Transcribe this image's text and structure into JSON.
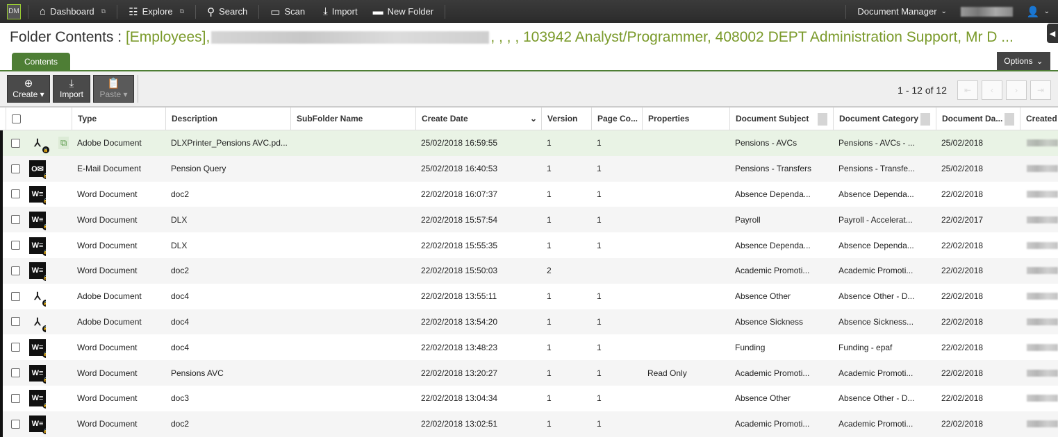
{
  "topbar": {
    "logo": "DM",
    "items": [
      {
        "label": "Dashboard",
        "icon": "home-icon"
      },
      {
        "label": "Explore",
        "icon": "explore-icon"
      },
      {
        "label": "Search",
        "icon": "search-icon"
      },
      {
        "label": "Scan",
        "icon": "scan-icon"
      },
      {
        "label": "Import",
        "icon": "import-icon"
      },
      {
        "label": "New Folder",
        "icon": "new-folder-icon"
      }
    ],
    "app_menu": "Document Manager"
  },
  "header": {
    "prefix": "Folder Contents :",
    "path_start": "[Employees],",
    "path_end": ", , , , 103942 Analyst/Programmer, 408002 DEPT Administration Support, Mr D ..."
  },
  "tabs": {
    "contents": "Contents",
    "options": "Options"
  },
  "toolbar": {
    "create": "Create",
    "import": "Import",
    "paste": "Paste"
  },
  "pager": {
    "count": "1 - 12 of 12"
  },
  "accent": "#4e7e35",
  "columns": [
    "Type",
    "Description",
    "SubFolder Name",
    "Create Date",
    "Version",
    "Page Co...",
    "Properties",
    "Document Subject",
    "Document Category",
    "Document Da...",
    "Created"
  ],
  "rows": [
    [
      "pdf",
      "Adobe Document",
      "DLXPrinter_Pensions AVC.pd...",
      "",
      "25/02/2018 16:59:55",
      "1",
      "1",
      "",
      "Pensions - AVCs",
      "Pensions - AVCs - ...",
      "25/02/2018"
    ],
    [
      "email",
      "E-Mail Document",
      "Pension Query",
      "",
      "25/02/2018 16:40:53",
      "1",
      "1",
      "",
      "Pensions - Transfers",
      "Pensions - Transfe...",
      "25/02/2018"
    ],
    [
      "word",
      "Word Document",
      "doc2",
      "",
      "22/02/2018 16:07:37",
      "1",
      "1",
      "",
      "Absence Dependa...",
      "Absence Dependa...",
      "22/02/2018"
    ],
    [
      "word",
      "Word Document",
      "DLX",
      "",
      "22/02/2018 15:57:54",
      "1",
      "1",
      "",
      "Payroll",
      "Payroll - Accelerat...",
      "22/02/2017"
    ],
    [
      "word",
      "Word Document",
      "DLX",
      "",
      "22/02/2018 15:55:35",
      "1",
      "1",
      "",
      "Absence Dependa...",
      "Absence Dependa...",
      "22/02/2018"
    ],
    [
      "word",
      "Word Document",
      "doc2",
      "",
      "22/02/2018 15:50:03",
      "2",
      "",
      "",
      "Academic Promoti...",
      "Academic Promoti...",
      "22/02/2018"
    ],
    [
      "pdf",
      "Adobe Document",
      "doc4",
      "",
      "22/02/2018 13:55:11",
      "1",
      "1",
      "",
      "Absence Other",
      "Absence Other - D...",
      "22/02/2018"
    ],
    [
      "pdf",
      "Adobe Document",
      "doc4",
      "",
      "22/02/2018 13:54:20",
      "1",
      "1",
      "",
      "Absence Sickness",
      "Absence Sickness...",
      "22/02/2018"
    ],
    [
      "word",
      "Word Document",
      "doc4",
      "",
      "22/02/2018 13:48:23",
      "1",
      "1",
      "",
      "Funding",
      "Funding - epaf",
      "22/02/2018"
    ],
    [
      "word",
      "Word Document",
      "Pensions AVC",
      "",
      "22/02/2018 13:20:27",
      "1",
      "1",
      "Read Only",
      "Academic Promoti...",
      "Academic Promoti...",
      "22/02/2018"
    ],
    [
      "word",
      "Word Document",
      "doc3",
      "",
      "22/02/2018 13:04:34",
      "1",
      "1",
      "",
      "Absence Other",
      "Absence Other - D...",
      "22/02/2018"
    ],
    [
      "word",
      "Word Document",
      "doc2",
      "",
      "22/02/2018 13:02:51",
      "1",
      "1",
      "",
      "Academic Promoti...",
      "Academic Promoti...",
      "22/02/2018"
    ]
  ]
}
